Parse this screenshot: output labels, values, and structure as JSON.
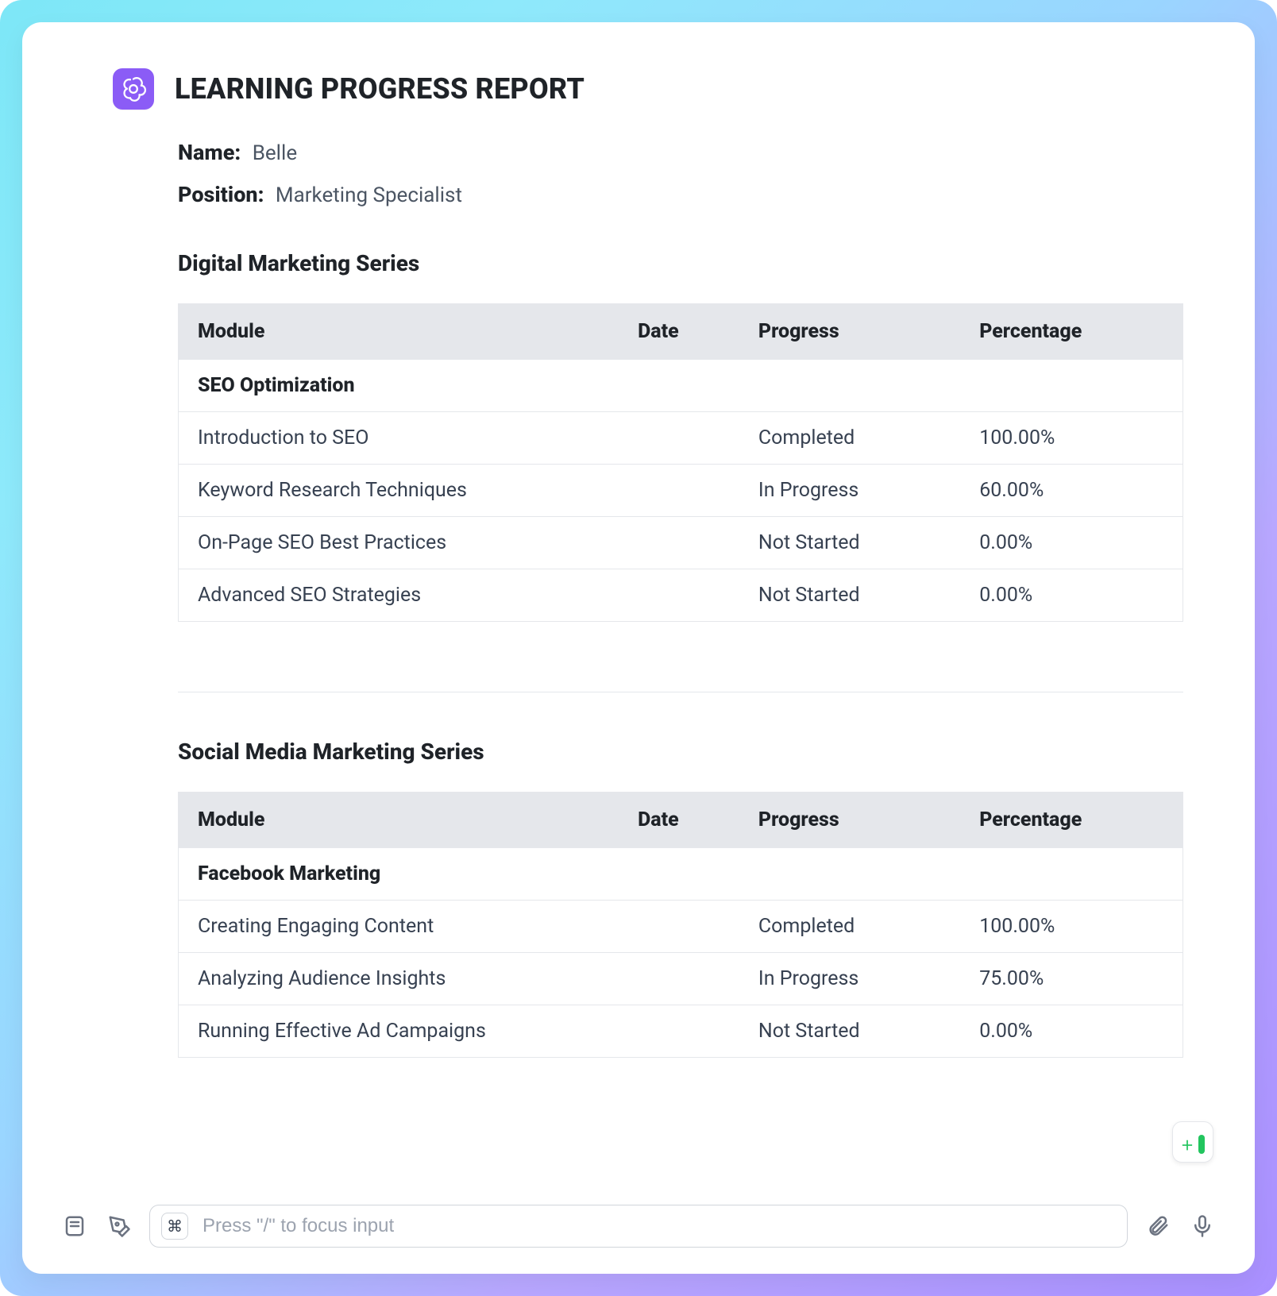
{
  "header": {
    "title": "LEARNING PROGRESS REPORT",
    "name_label": "Name:",
    "name_value": "Belle",
    "position_label": "Position:",
    "position_value": "Marketing Specialist"
  },
  "table_headers": {
    "module": "Module",
    "date": "Date",
    "progress": "Progress",
    "percentage": "Percentage"
  },
  "series1": {
    "title": "Digital Marketing Series",
    "group": "SEO Optimization",
    "rows": [
      {
        "module": "Introduction to SEO",
        "date": "",
        "progress": "Completed",
        "percentage": "100.00%"
      },
      {
        "module": "Keyword Research Techniques",
        "date": "",
        "progress": "In Progress",
        "percentage": "60.00%"
      },
      {
        "module": "On-Page SEO Best Practices",
        "date": "",
        "progress": "Not Started",
        "percentage": "0.00%"
      },
      {
        "module": "Advanced SEO Strategies",
        "date": "",
        "progress": "Not Started",
        "percentage": "0.00%"
      }
    ]
  },
  "series2": {
    "title": "Social Media Marketing Series",
    "group": "Facebook Marketing",
    "rows": [
      {
        "module": "Creating Engaging Content",
        "date": "",
        "progress": "Completed",
        "percentage": "100.00%"
      },
      {
        "module": "Analyzing Audience Insights",
        "date": "",
        "progress": "In Progress",
        "percentage": "75.00%"
      },
      {
        "module": "Running Effective Ad Campaigns",
        "date": "",
        "progress": "Not Started",
        "percentage": "0.00%"
      }
    ]
  },
  "input": {
    "command_key": "⌘",
    "placeholder": "Press \"/\" to focus input"
  }
}
